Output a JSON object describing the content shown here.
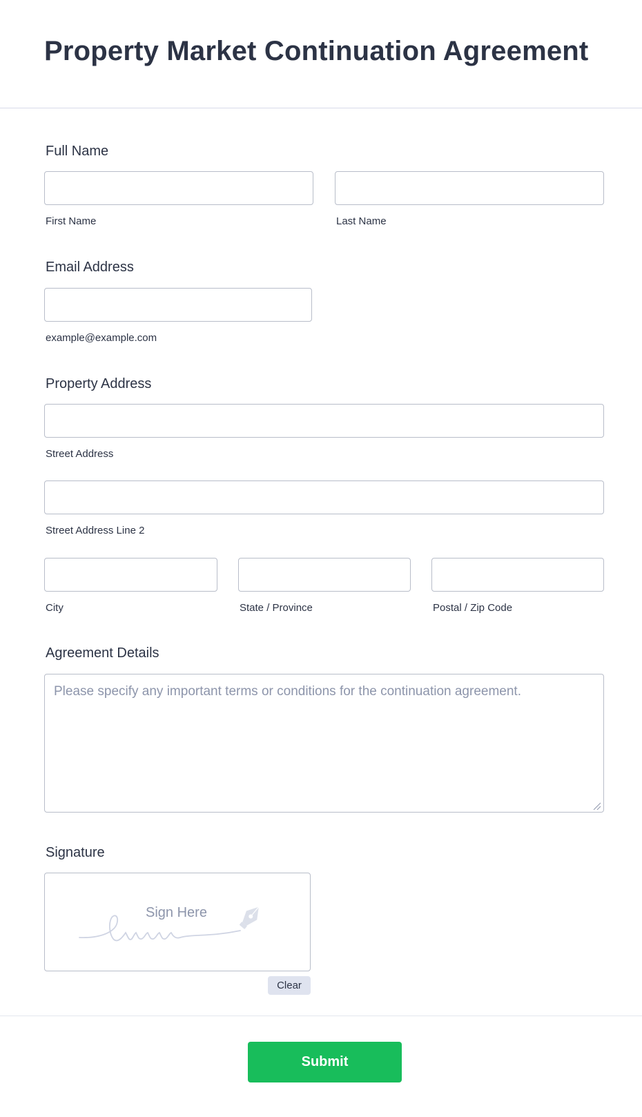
{
  "form": {
    "title": "Property Market Continuation Agreement"
  },
  "full_name": {
    "label": "Full Name",
    "first": {
      "sub_label": "First Name",
      "value": ""
    },
    "last": {
      "sub_label": "Last Name",
      "value": ""
    }
  },
  "email": {
    "label": "Email Address",
    "sub_label": "example@example.com",
    "value": ""
  },
  "address": {
    "label": "Property Address",
    "street": {
      "sub_label": "Street Address",
      "value": ""
    },
    "street2": {
      "sub_label": "Street Address Line 2",
      "value": ""
    },
    "city": {
      "sub_label": "City",
      "value": ""
    },
    "state": {
      "sub_label": "State / Province",
      "value": ""
    },
    "postal": {
      "sub_label": "Postal / Zip Code",
      "value": ""
    }
  },
  "agreement": {
    "label": "Agreement Details",
    "placeholder": "Please specify any important terms or conditions for the continuation agreement.",
    "value": ""
  },
  "signature": {
    "label": "Signature",
    "pad_text": "Sign Here",
    "clear_label": "Clear",
    "icon": "pen-nib-icon"
  },
  "actions": {
    "submit_label": "Submit"
  },
  "colors": {
    "submit_bg": "#18bd5b",
    "text": "#2c3345",
    "field_border": "#b8bdc9",
    "placeholder": "#8d95ab",
    "clear_bg": "#dfe3ef"
  }
}
